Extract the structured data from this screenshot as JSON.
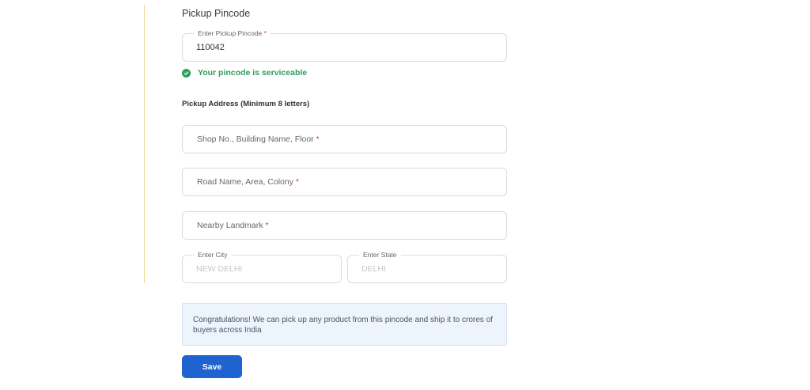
{
  "section_title": "Pickup Pincode",
  "pincode": {
    "legend": "Enter Pickup Pincode",
    "required_mark": "*",
    "value": "110042"
  },
  "pincode_status": "Your pincode is serviceable",
  "address": {
    "title": "Pickup Address (Minimum 8 letters)",
    "fields": [
      {
        "placeholder": "Shop No., Building Name, Floor",
        "required_mark": "*"
      },
      {
        "placeholder": "Road Name, Area, Colony",
        "required_mark": "*"
      },
      {
        "placeholder": "Nearby Landmark",
        "required_mark": "*"
      }
    ]
  },
  "city": {
    "legend": "Enter City",
    "value": "NEW DELHI"
  },
  "state": {
    "legend": "Enter State",
    "value": "DELHI"
  },
  "info_message": "Congratulations! We can pick up any product from this pincode and ship it to crores of buyers across India",
  "save_label": "Save",
  "colors": {
    "primary": "#1f63d1",
    "success": "#2e9e5b",
    "required": "#e53935",
    "info_bg": "#eef4fc",
    "divider": "#f1d79a"
  },
  "icons": {
    "status": "check-circle-icon"
  }
}
